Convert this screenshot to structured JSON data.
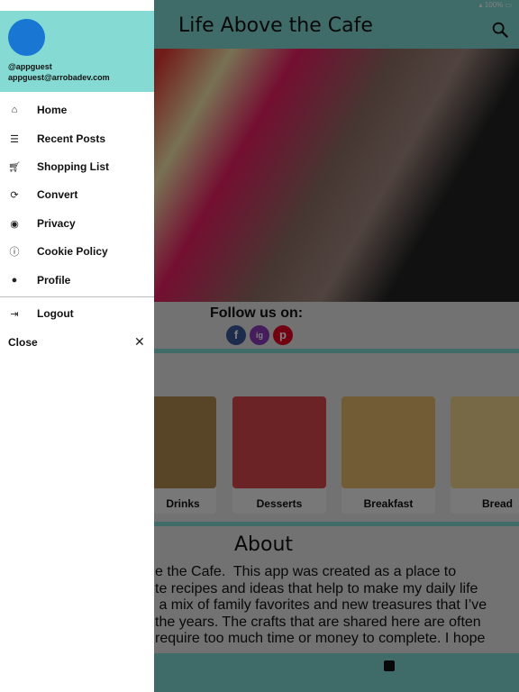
{
  "status": {
    "battery": "100%"
  },
  "header": {
    "title": "Life Above the Cafe",
    "search_icon": "search-icon"
  },
  "follow": {
    "label": "Follow us on:",
    "networks": [
      "f",
      "ig",
      "p"
    ]
  },
  "categories": [
    {
      "label": "Drinks"
    },
    {
      "label": "Desserts"
    },
    {
      "label": "Breakfast"
    },
    {
      "label": "Bread"
    }
  ],
  "about": {
    "title": "About",
    "text": "e the Cafe.  This app was created as a place to\nte recipes and ideas that help to make my daily life\n a mix of family favorites and new treasures that I’ve\nthe years. The crafts that are shared here are often\nrequire too much time or money to complete. I hope"
  },
  "drawer": {
    "username": "@appguest",
    "email": "appguest@arrobadev.com",
    "items": [
      {
        "label": "Home",
        "icon": "home-icon"
      },
      {
        "label": "Recent Posts",
        "icon": "list-icon"
      },
      {
        "label": "Shopping List",
        "icon": "cart-icon"
      },
      {
        "label": "Convert",
        "icon": "refresh-icon"
      },
      {
        "label": "Privacy",
        "icon": "eye-icon"
      },
      {
        "label": "Cookie Policy",
        "icon": "info-icon"
      },
      {
        "label": "Profile",
        "icon": "account-icon"
      }
    ],
    "logout": "Logout",
    "close": "Close"
  },
  "colors": {
    "accent": "#85dbd3",
    "avatar": "#1976d2"
  }
}
